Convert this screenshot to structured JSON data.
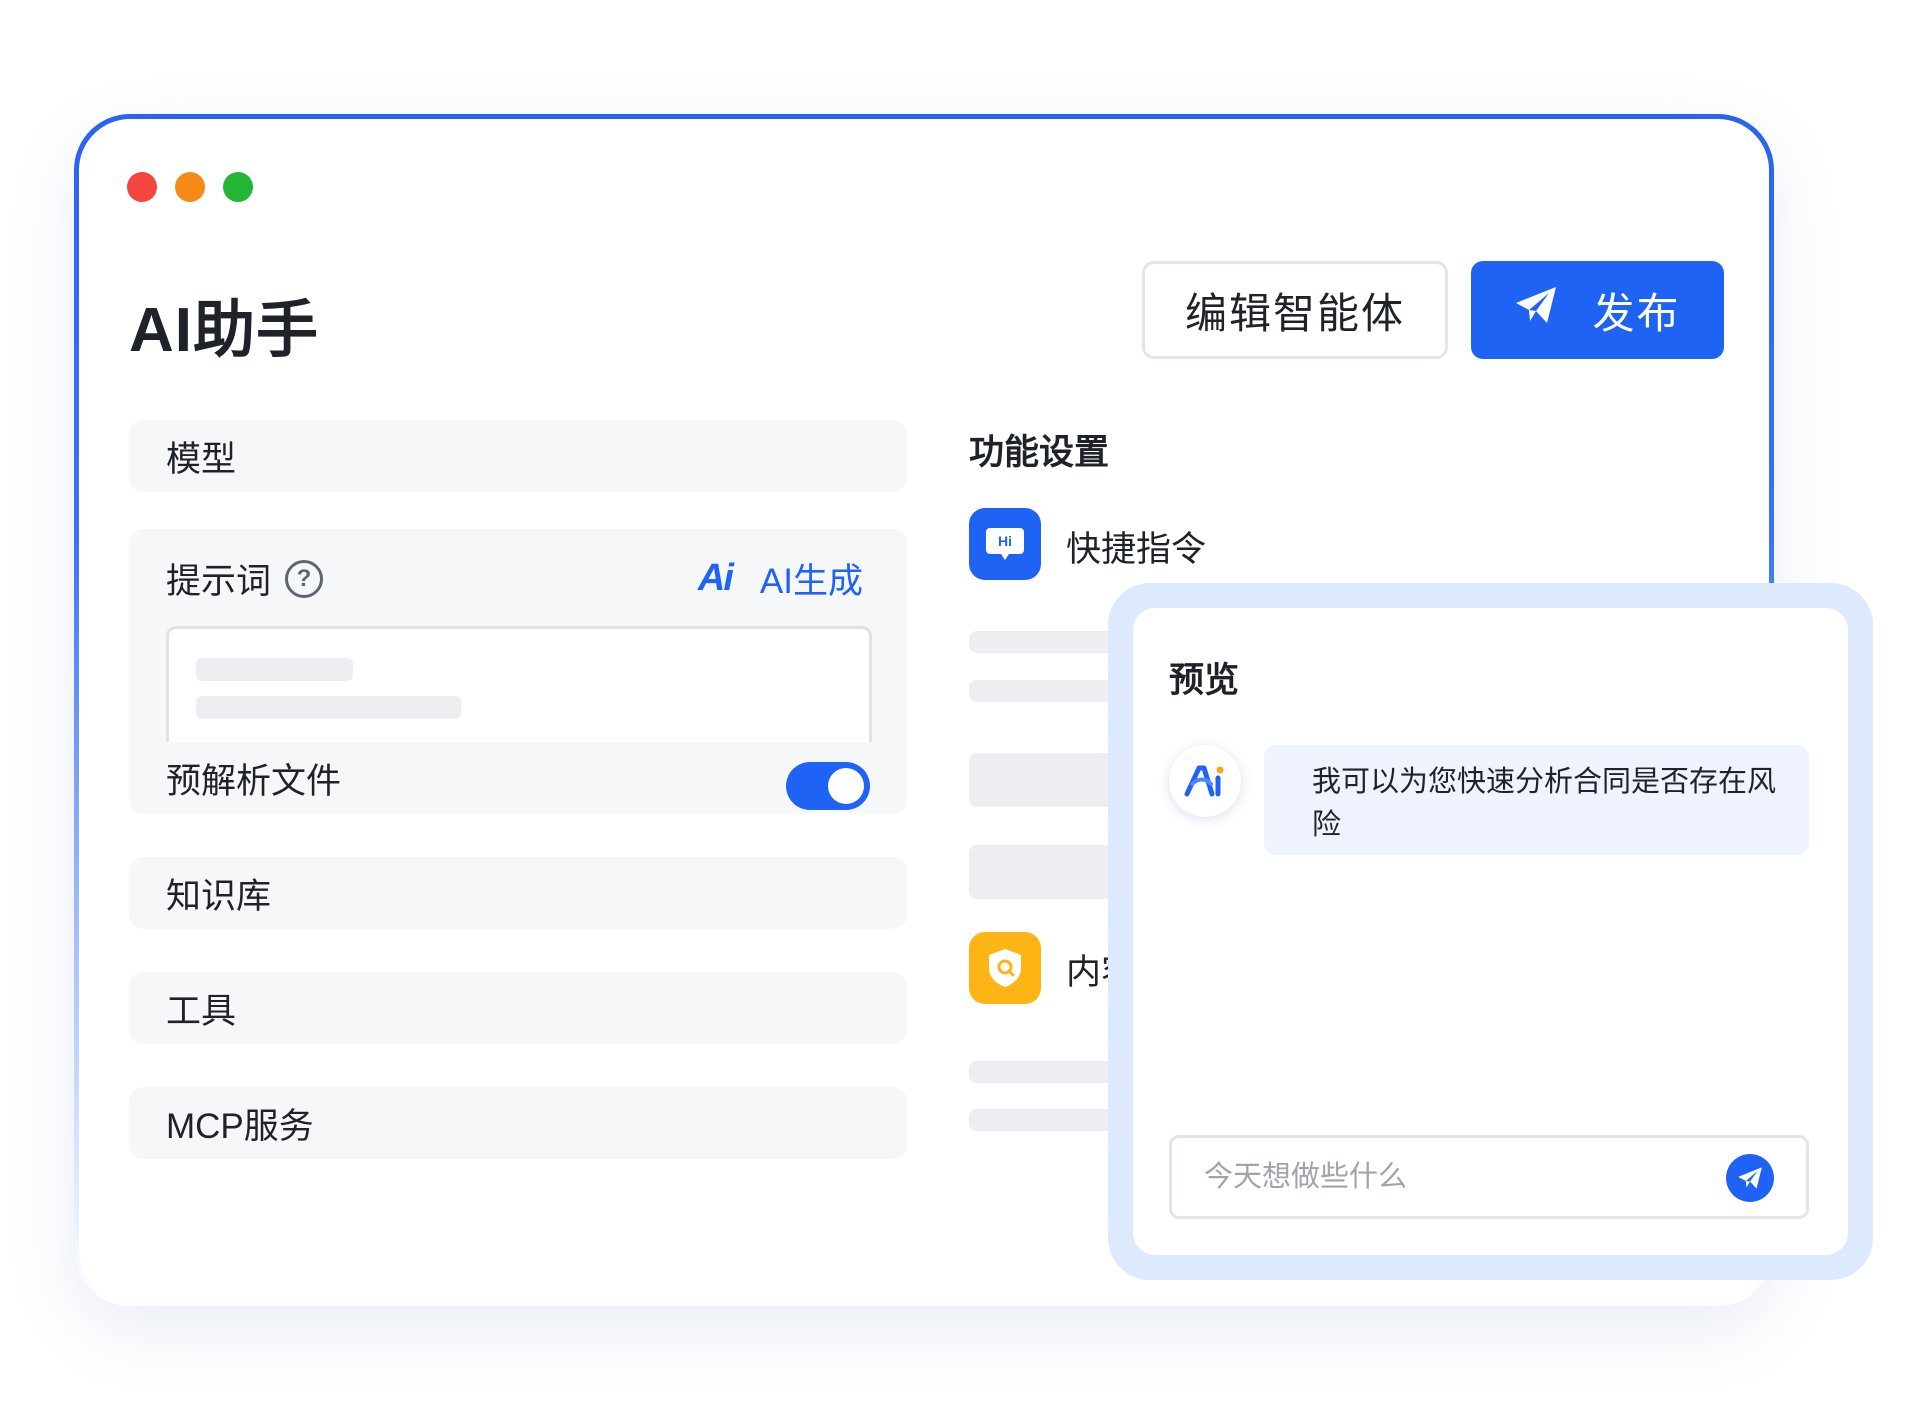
{
  "window": {
    "controls": [
      "close-dot",
      "minimize-dot",
      "maximize-dot"
    ]
  },
  "header": {
    "title": "AI助手",
    "edit_button": "编辑智能体",
    "publish_button": "发布"
  },
  "left_panel": {
    "model_label": "模型",
    "prompt": {
      "label": "提示词",
      "help_icon": "question-circle-icon",
      "ai_generate_mark": "Ai",
      "ai_generate_label": "AI生成"
    },
    "pre_parse": {
      "label": "预解析文件",
      "toggle_on": true
    },
    "knowledge_label": "知识库",
    "tools_label": "工具",
    "mcp_label": "MCP服务"
  },
  "features": {
    "title": "功能设置",
    "items": [
      {
        "label": "快捷指令",
        "icon": "hi-chat-icon",
        "color": "#1f63f5"
      },
      {
        "label": "内容",
        "icon": "shield-search-icon",
        "color": "#fdb515"
      }
    ]
  },
  "preview": {
    "title": "预览",
    "message": "我可以为您快速分析合同是否存在风险",
    "avatar_icon": "ai-logo-icon",
    "input_placeholder": "今天想做些什么",
    "send_icon": "send-icon"
  },
  "colors": {
    "accent": "#1f63f5",
    "panel_bg": "#f6f7f9",
    "preview_frame": "#dde9fd",
    "feature_orange": "#fdb515"
  }
}
